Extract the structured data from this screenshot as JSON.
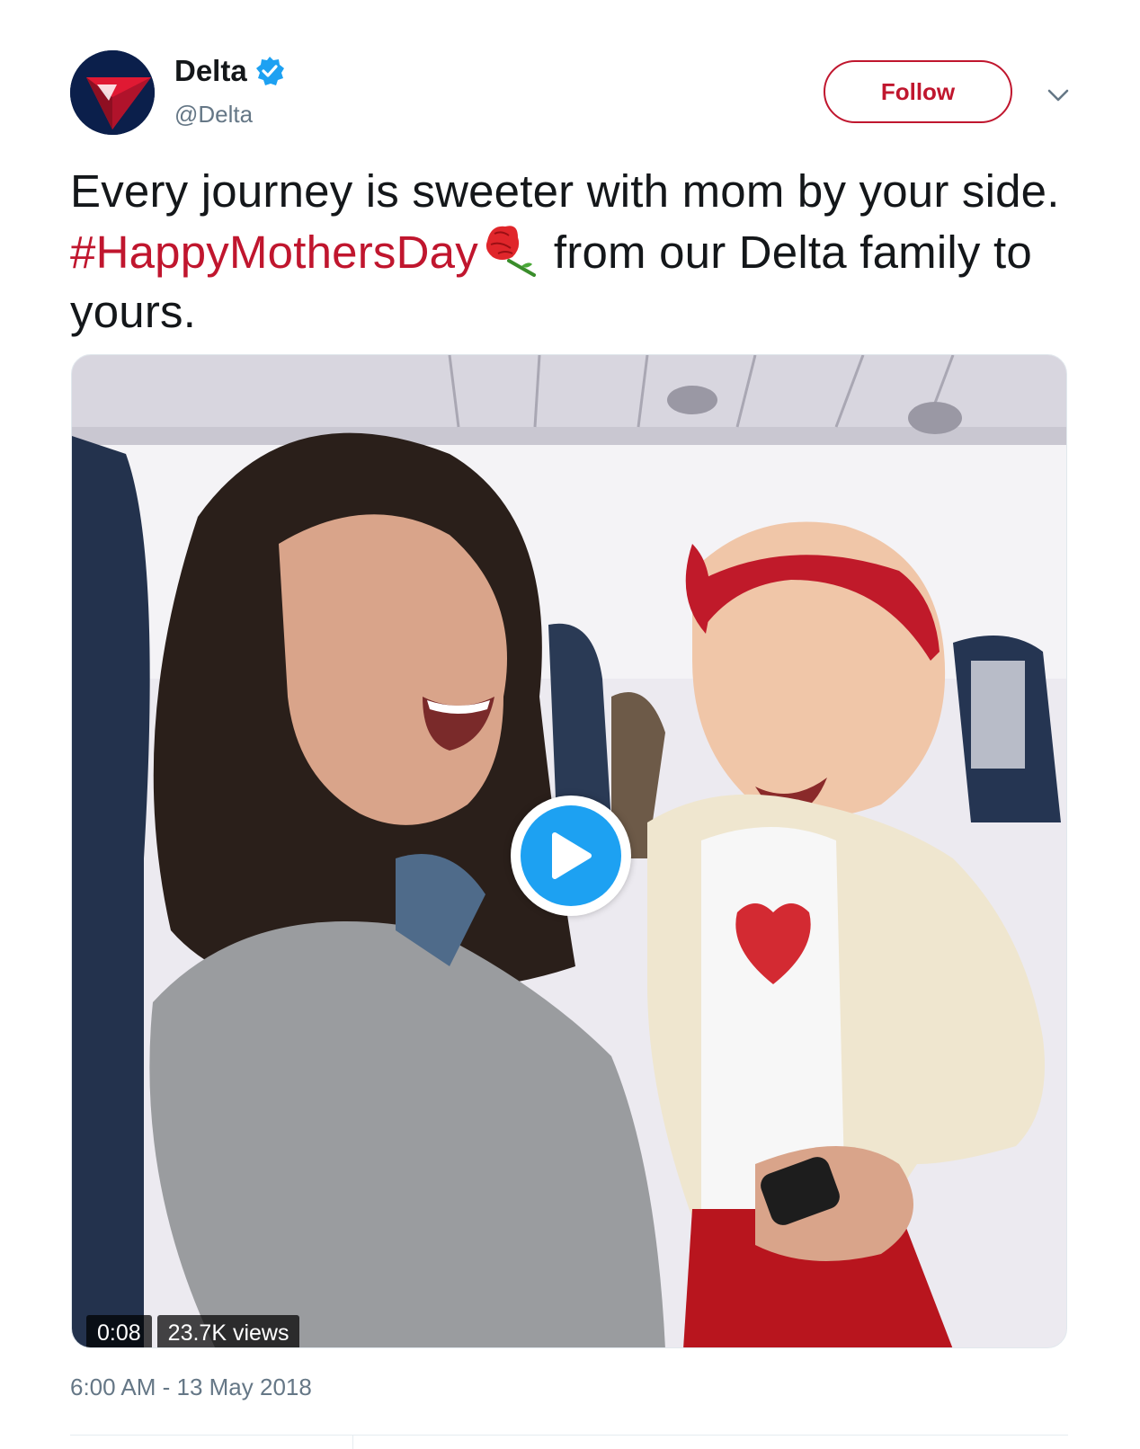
{
  "author": {
    "display_name": "Delta",
    "handle": "@Delta",
    "verified": true,
    "avatar_icon": "delta-logo-icon",
    "brand_colors": {
      "red": "#c0162e",
      "navy": "#0b1f4b"
    }
  },
  "actions": {
    "follow_label": "Follow",
    "more_icon": "chevron-down-icon"
  },
  "tweet": {
    "text_before": "Every journey is sweeter with mom by your side.",
    "hashtag": "#HappyMothersDay",
    "emoji_icon": "rose-flower-icon",
    "text_after": "from our Delta family to yours."
  },
  "video": {
    "duration": "0:08",
    "views": "23.7K views",
    "play_icon": "play-icon",
    "play_color": "#1da1f2"
  },
  "timestamp": "6:00 AM - 13 May 2018"
}
